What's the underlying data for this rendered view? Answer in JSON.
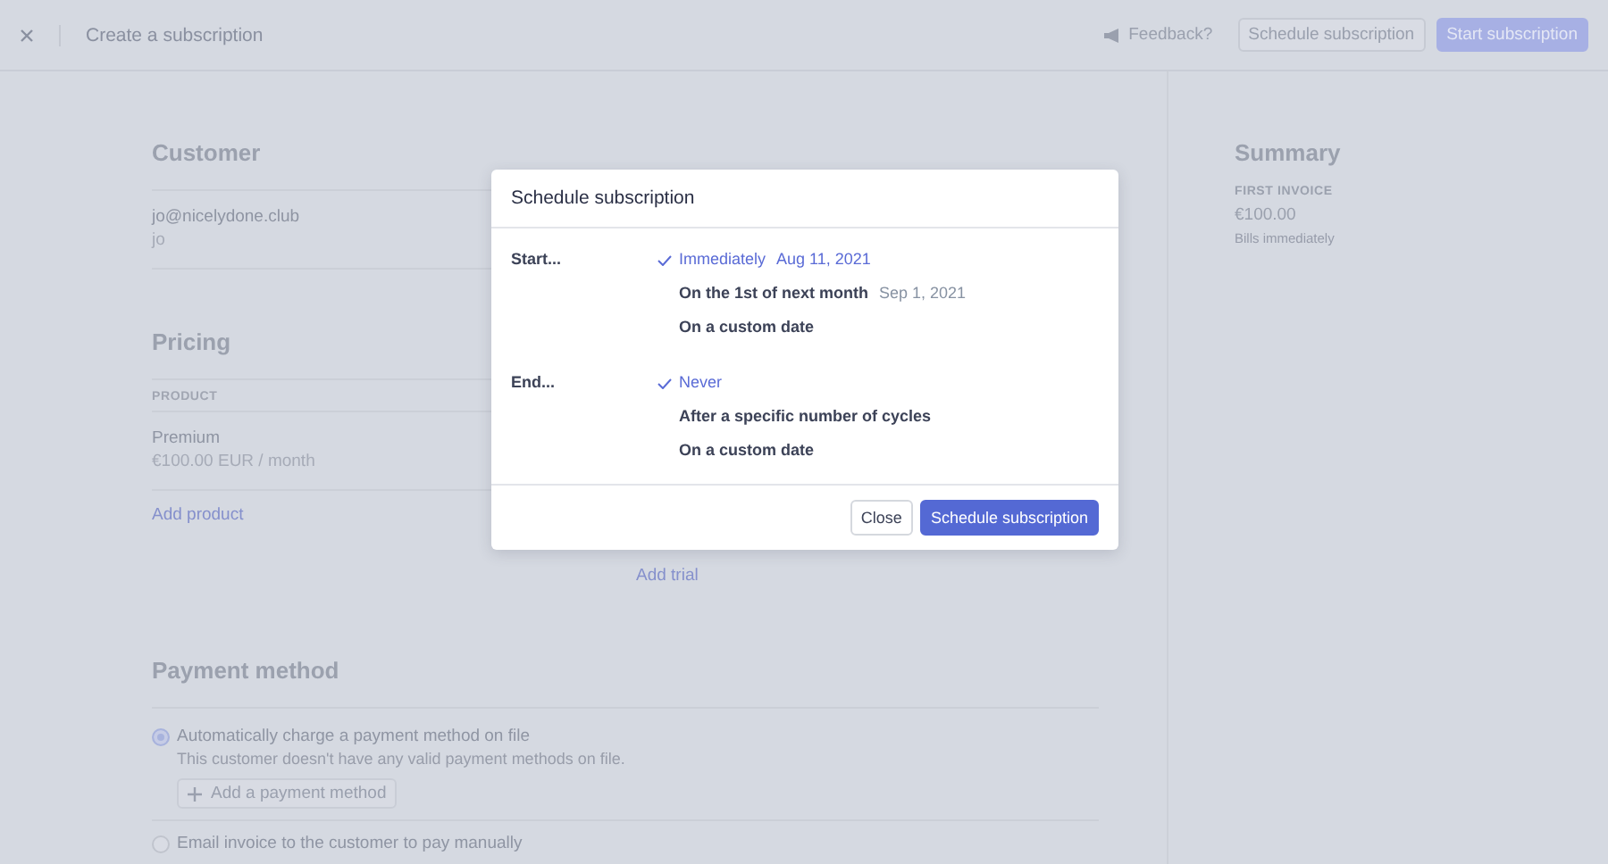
{
  "header": {
    "title": "Create a subscription",
    "feedback": "Feedback?",
    "buttons": [
      {
        "label": "Schedule subscription",
        "kind": "secondary"
      },
      {
        "label": "Start subscription",
        "kind": "primary"
      }
    ]
  },
  "customer": {
    "heading": "Customer",
    "email": "jo@nicelydone.club",
    "name": "jo"
  },
  "pricing": {
    "heading": "Pricing",
    "column_1": "PRODUCT",
    "product": "Premium",
    "price": "€100.00 EUR / month",
    "add_product": "Add product",
    "add_trial": "Add trial"
  },
  "payment": {
    "heading": "Payment method",
    "options": [
      {
        "label": "Automatically charge a payment method on file",
        "description": "This customer doesn't have any valid payment methods on file.",
        "button": "Add a payment method",
        "selected": true
      },
      {
        "label": "Email invoice to the customer to pay manually",
        "selected": false
      }
    ]
  },
  "summary": {
    "heading": "Summary",
    "label": "FIRST INVOICE",
    "amount": "€100.00",
    "note": "Bills immediately"
  },
  "modal": {
    "title": "Schedule subscription",
    "groups": [
      {
        "label": "Start...",
        "options": [
          {
            "label": "Immediately",
            "date": "Aug 11, 2021",
            "selected": true
          },
          {
            "label": "On the 1st of next month",
            "date": "Sep 1, 2021",
            "selected": false
          },
          {
            "label": "On a custom date",
            "selected": false
          }
        ]
      },
      {
        "label": "End...",
        "options": [
          {
            "label": "Never",
            "selected": true
          },
          {
            "label": "After a specific number of cycles",
            "selected": false
          },
          {
            "label": "On a custom date",
            "selected": false
          }
        ]
      }
    ],
    "buttons": [
      {
        "label": "Close",
        "kind": "secondary"
      },
      {
        "label": "Schedule subscription",
        "kind": "primary"
      }
    ]
  }
}
